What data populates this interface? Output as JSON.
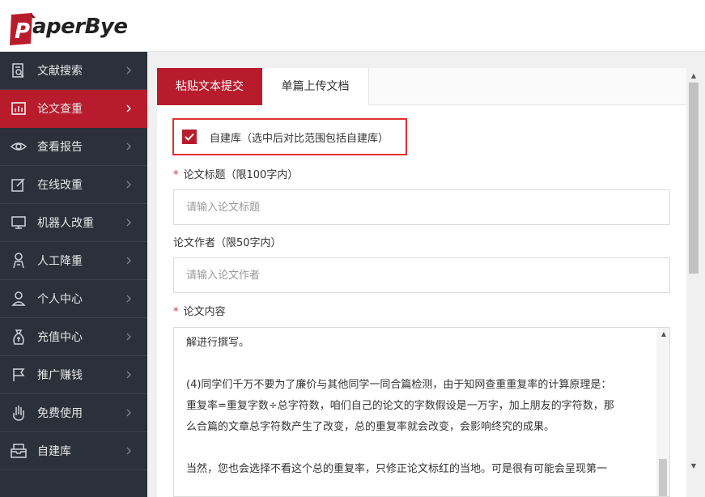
{
  "brand": {
    "name": "PaperBye",
    "logo_letter": "P",
    "accent": "#b81c2c"
  },
  "sidebar": {
    "items": [
      {
        "label": "文献搜索",
        "icon": "document-search-icon"
      },
      {
        "label": "论文查重",
        "icon": "chart-report-icon",
        "active": true
      },
      {
        "label": "查看报告",
        "icon": "eye-icon"
      },
      {
        "label": "在线改重",
        "icon": "edit-icon"
      },
      {
        "label": "机器人改重",
        "icon": "monitor-icon"
      },
      {
        "label": "人工降重",
        "icon": "person-icon"
      },
      {
        "label": "个人中心",
        "icon": "user-icon"
      },
      {
        "label": "充值中心",
        "icon": "wallet-icon"
      },
      {
        "label": "推广赚钱",
        "icon": "flag-icon"
      },
      {
        "label": "免费使用",
        "icon": "hand-icon"
      },
      {
        "label": "自建库",
        "icon": "inbox-icon"
      }
    ]
  },
  "tabs": [
    {
      "label": "粘贴文本提交",
      "active": true
    },
    {
      "label": "单篇上传文档",
      "active": false
    }
  ],
  "form": {
    "own_library": {
      "label": "自建库（选中后对比范围包括自建库）",
      "checked": true
    },
    "title": {
      "label": "论文标题（限100字内）",
      "required_mark": "*",
      "placeholder": "请输入论文标题"
    },
    "author": {
      "label": "论文作者（限50字内）",
      "placeholder": "请输入论文作者"
    },
    "content": {
      "label": "论文内容",
      "required_mark": "*",
      "lines": [
        "解进行撰写。",
        "",
        "(4)同学们千万不要为了廉价与其他同学一同合篇检测，由于知网查重重复率的计算原理是：",
        "重复率=重复字数÷总字符数，咱们自己的论文的字数假设是一万字，加上朋友的字符数，那",
        "么合篇的文章总字符数产生了改变，总的重复率就会改变，会影响终究的成果。",
        "",
        "当然，您也会选择不看这个总的重复率，只修正论文标红的当地。可是很有可能会呈现第一"
      ]
    }
  }
}
